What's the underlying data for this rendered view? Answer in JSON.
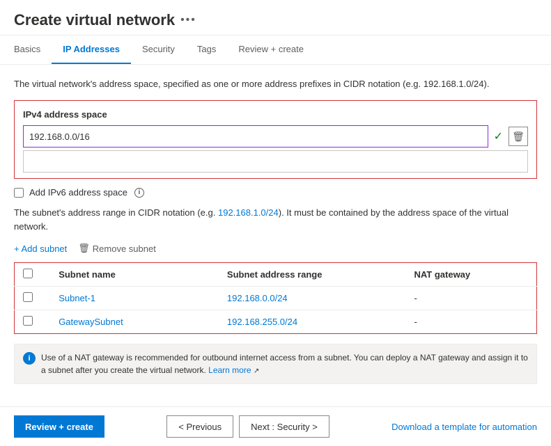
{
  "header": {
    "title": "Create virtual network",
    "more_icon": "•••"
  },
  "tabs": [
    {
      "label": "Basics",
      "active": false
    },
    {
      "label": "IP Addresses",
      "active": true
    },
    {
      "label": "Security",
      "active": false
    },
    {
      "label": "Tags",
      "active": false
    },
    {
      "label": "Review + create",
      "active": false
    }
  ],
  "main": {
    "description": "The virtual network's address space, specified as one or more address prefixes in CIDR notation (e.g. 192.168.1.0/24).",
    "ipv4_label": "IPv4 address space",
    "ipv4_value": "192.168.0.0/16",
    "ipv6_label": "Add IPv6 address space",
    "subnet_desc_part1": "The subnet's address range in CIDR notation (e.g. ",
    "subnet_desc_link": "192.168.1.0/24",
    "subnet_desc_part2": "). It must be contained by the address space of the virtual network.",
    "add_subnet_label": "+ Add subnet",
    "remove_subnet_label": "Remove subnet",
    "table": {
      "headers": [
        "",
        "Subnet name",
        "Subnet address range",
        "NAT gateway"
      ],
      "rows": [
        {
          "name": "Subnet-1",
          "range": "192.168.0.0/24",
          "nat": "-"
        },
        {
          "name": "GatewaySubnet",
          "range": "192.168.255.0/24",
          "nat": "-"
        }
      ]
    },
    "nat_info": "Use of a NAT gateway is recommended for outbound internet access from a subnet. You can deploy a NAT gateway and assign it to a subnet after you create the virtual network.",
    "learn_more": "Learn more"
  },
  "footer": {
    "review_create_label": "Review + create",
    "previous_label": "< Previous",
    "next_label": "Next : Security >",
    "download_label": "Download a template for automation"
  }
}
